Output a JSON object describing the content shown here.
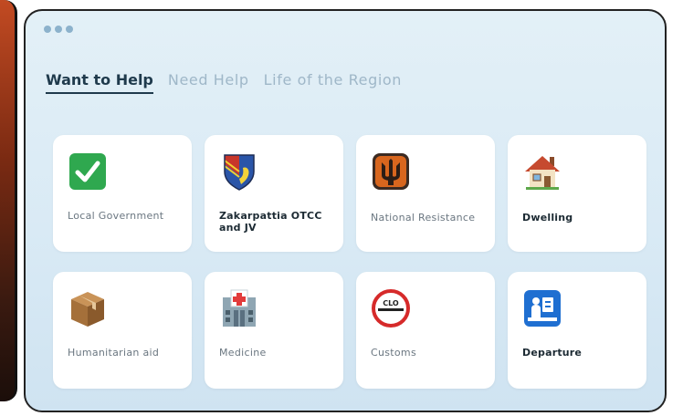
{
  "window": {
    "dots": 3
  },
  "tabs": [
    {
      "label": "Want to Help",
      "active": true
    },
    {
      "label": "Need Help",
      "active": false
    },
    {
      "label": "Life of the Region",
      "active": false
    }
  ],
  "cards": [
    {
      "label": "Local Government",
      "icon": "check-mark-icon"
    },
    {
      "label": "Zakarpattia OTCC and JV",
      "icon": "coat-of-arms-icon"
    },
    {
      "label": "National Resistance",
      "icon": "trident-icon"
    },
    {
      "label": "Dwelling",
      "icon": "house-icon"
    },
    {
      "label": "Humanitarian aid",
      "icon": "package-box-icon"
    },
    {
      "label": "Medicine",
      "icon": "hospital-icon"
    },
    {
      "label": "Customs",
      "icon": "customs-sign-icon"
    },
    {
      "label": "Departure",
      "icon": "passport-control-icon"
    }
  ],
  "sign_text": "CLO",
  "colors": {
    "accent": "#1f3a4c",
    "tab_inactive": "#9fb7c8",
    "window_bg": "#dceaf4"
  }
}
